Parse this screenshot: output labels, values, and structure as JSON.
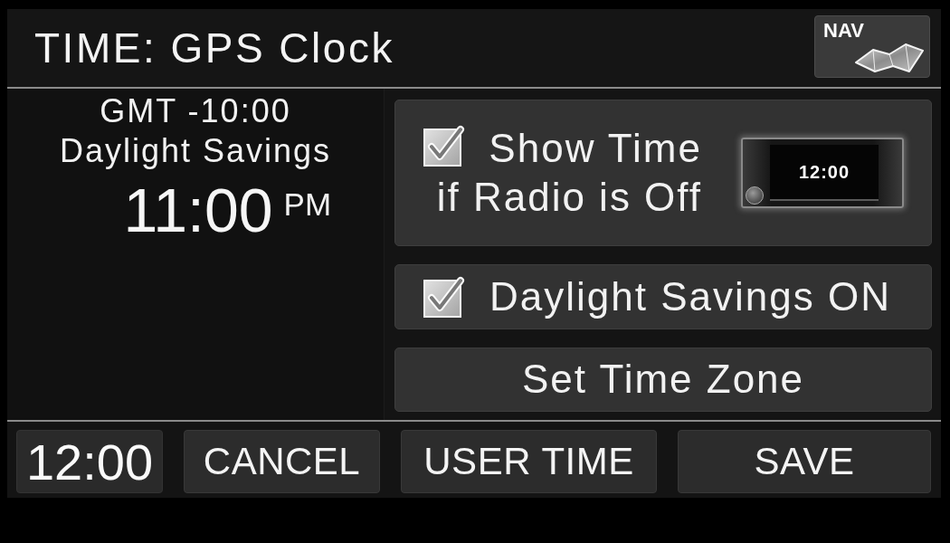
{
  "header": {
    "title": "TIME: GPS Clock",
    "nav_button": "NAV"
  },
  "clock_info": {
    "zone": "GMT -10:00",
    "mode": "Daylight Savings",
    "time": "11:00",
    "meridiem": "PM"
  },
  "options": [
    {
      "kind": "checkbox",
      "label": "Show Time\nif Radio is Off",
      "checked": true,
      "preview": "12:00"
    },
    {
      "kind": "checkbox",
      "label": "Daylight Savings ON",
      "checked": true
    },
    {
      "kind": "button",
      "label": "Set Time Zone"
    }
  ],
  "footer": {
    "clock": "12:00",
    "buttons": [
      "CANCEL",
      "USER TIME",
      "SAVE"
    ]
  }
}
